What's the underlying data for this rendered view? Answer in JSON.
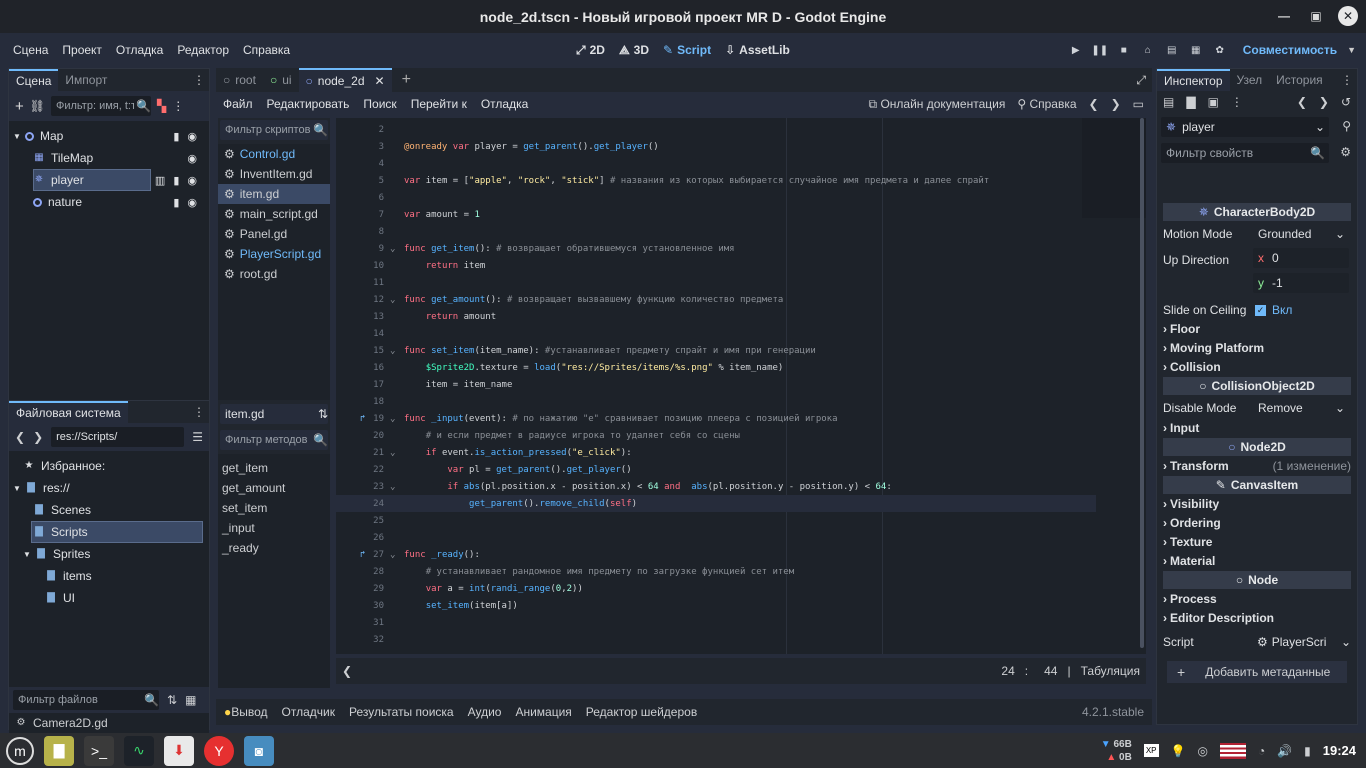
{
  "window": {
    "title": "node_2d.tscn - Новый игровой проект MR D - Godot Engine"
  },
  "menu": [
    "Сцена",
    "Проект",
    "Отладка",
    "Редактор",
    "Справка"
  ],
  "workspaces": {
    "w2d": "2D",
    "w3d": "3D",
    "script": "Script",
    "assetlib": "AssetLib"
  },
  "renderer": "Совместимость",
  "scene_dock": {
    "tabs": [
      "Сцена",
      "Импорт"
    ],
    "filter_placeholder": "Фильтр: имя, t:тип",
    "nodes": [
      "Map",
      "TileMap",
      "player",
      "nature"
    ]
  },
  "filesystem": {
    "tab": "Файловая система",
    "path": "res://Scripts/",
    "items": [
      "Избранное:",
      "res://",
      "Scenes",
      "Scripts",
      "Sprites",
      "items",
      "UI"
    ],
    "filter_placeholder": "Фильтр файлов",
    "bottom_file": "Camera2D.gd"
  },
  "scene_tabs": [
    "root",
    "ui",
    "node_2d"
  ],
  "script_menu": [
    "Файл",
    "Редактировать",
    "Поиск",
    "Перейти к",
    "Отладка"
  ],
  "docs": {
    "online": "Онлайн документация",
    "help": "Справка"
  },
  "scripts_filter": "Фильтр скриптов",
  "scripts": [
    "Control.gd",
    "InventItem.gd",
    "item.gd",
    "main_script.gd",
    "Panel.gd",
    "PlayerScript.gd",
    "root.gd"
  ],
  "current_script": "item.gd",
  "methods_filter": "Фильтр методов",
  "methods": [
    "get_item",
    "get_amount",
    "set_item",
    "_input",
    "_ready"
  ],
  "code_lines": [
    {
      "n": "2",
      "html": ""
    },
    {
      "n": "3",
      "html": "<span class='ann'>@onready</span> <span class='kw'>var</span> player = <span class='fn'>get_parent</span>().<span class='fn'>get_player</span>()"
    },
    {
      "n": "4",
      "html": ""
    },
    {
      "n": "5",
      "html": "<span class='kw'>var</span> item = [<span class='str'>\"apple\"</span>, <span class='str'>\"rock\"</span>, <span class='str'>\"stick\"</span>] <span class='cm'># названия из которых выбирается случайное имя предмета и далее спрайт</span>"
    },
    {
      "n": "6",
      "html": ""
    },
    {
      "n": "7",
      "html": "<span class='kw'>var</span> amount = <span class='num'>1</span>"
    },
    {
      "n": "8",
      "html": ""
    },
    {
      "n": "9",
      "html": "<span class='kw'>func</span> <span class='fn'>get_item</span>(): <span class='cm'># возвращает обратившемуся установленное имя</span>"
    },
    {
      "n": "10",
      "html": "    <span class='kw'>return</span> item"
    },
    {
      "n": "11",
      "html": ""
    },
    {
      "n": "12",
      "html": "<span class='kw'>func</span> <span class='fn'>get_amount</span>(): <span class='cm'># возвращает вызвавшему функцию количество предмета</span>"
    },
    {
      "n": "13",
      "html": "    <span class='kw'>return</span> amount"
    },
    {
      "n": "14",
      "html": ""
    },
    {
      "n": "15",
      "html": "<span class='kw'>func</span> <span class='fn'>set_item</span>(item_name): <span class='cm'>#устанавливает предмету спрайт и имя при генерации</span>"
    },
    {
      "n": "16",
      "html": "    <span class='typ'>$Sprite2D</span>.texture = <span class='fn'>load</span>(<span class='str'>\"res://Sprites/items/%s.png\"</span> % item_name)"
    },
    {
      "n": "17",
      "html": "    item = item_name"
    },
    {
      "n": "18",
      "html": ""
    },
    {
      "n": "19",
      "html": "<span class='kw'>func</span> <span class='fn'>_input</span>(event): <span class='cm'># по нажатию \"e\" сравнивает позицию плеера с позицией игрока</span>"
    },
    {
      "n": "20",
      "html": "    <span class='cm'># и если предмет в радиусе игрока то удаляет себя со сцены</span>"
    },
    {
      "n": "21",
      "html": "    <span class='kw'>if</span> event.<span class='fn'>is_action_pressed</span>(<span class='str'>\"e_click\"</span>):"
    },
    {
      "n": "22",
      "html": "        <span class='kw'>var</span> pl = <span class='fn'>get_parent</span>().<span class='fn'>get_player</span>()"
    },
    {
      "n": "23",
      "html": "        <span class='kw'>if</span> <span class='fn'>abs</span>(pl.position.x - position.x) &lt; <span class='num'>64</span> <span class='kw'>and</span>  <span class='fn'>abs</span>(pl.position.y - position.y) &lt; <span class='num'>64</span>:"
    },
    {
      "n": "24",
      "html": "            <span class='fn'>get_parent</span>().<span class='fn'>remove_child</span>(<span class='kw'>self</span>)"
    },
    {
      "n": "25",
      "html": ""
    },
    {
      "n": "26",
      "html": ""
    },
    {
      "n": "27",
      "html": "<span class='kw'>func</span> <span class='fn'>_ready</span>():"
    },
    {
      "n": "28",
      "html": "    <span class='cm'># устанавливает рандомное имя предмету по загрузке функцией сет итем</span>"
    },
    {
      "n": "29",
      "html": "    <span class='kw'>var</span> a = <span class='fn'>int</span>(<span class='fn'>randi_range</span>(<span class='num'>0</span>,<span class='num'>2</span>))"
    },
    {
      "n": "30",
      "html": "    <span class='fn'>set_item</span>(item[a])"
    },
    {
      "n": "31",
      "html": ""
    },
    {
      "n": "32",
      "html": ""
    }
  ],
  "status": {
    "line": "24",
    "sep": ":",
    "col": "44",
    "indent": "Табуляция"
  },
  "bottom_tabs": [
    "Вывод",
    "Отладчик",
    "Результаты поиска",
    "Аудио",
    "Анимация",
    "Редактор шейдеров"
  ],
  "version": "4.2.1.stable",
  "inspector": {
    "tabs": [
      "Инспектор",
      "Узел",
      "История"
    ],
    "node": "player",
    "filter_placeholder": "Фильтр свойств",
    "class1": "CharacterBody2D",
    "motion_mode_label": "Motion Mode",
    "motion_mode": "Grounded",
    "up_direction_label": "Up Direction",
    "up_x_label": "x",
    "up_x": "0",
    "up_y_label": "y",
    "up_y": "-1",
    "slide_label": "Slide on Ceiling",
    "slide_value": "Вкл",
    "sections1": [
      "Floor",
      "Moving Platform",
      "Collision"
    ],
    "class2": "CollisionObject2D",
    "disable_mode_label": "Disable Mode",
    "disable_mode": "Remove",
    "input_section": "Input",
    "class3": "Node2D",
    "transform_section": "Transform",
    "transform_changes": "(1 изменение)",
    "class4": "CanvasItem",
    "sections2": [
      "Visibility",
      "Ordering",
      "Texture",
      "Material"
    ],
    "class5": "Node",
    "sections3": [
      "Process",
      "Editor Description"
    ],
    "script_label": "Script",
    "script_value": "PlayerScri",
    "add_meta": "Добавить метаданные"
  },
  "tray": {
    "net_down": "66B",
    "net_up": "0B",
    "clock": "19:24"
  }
}
